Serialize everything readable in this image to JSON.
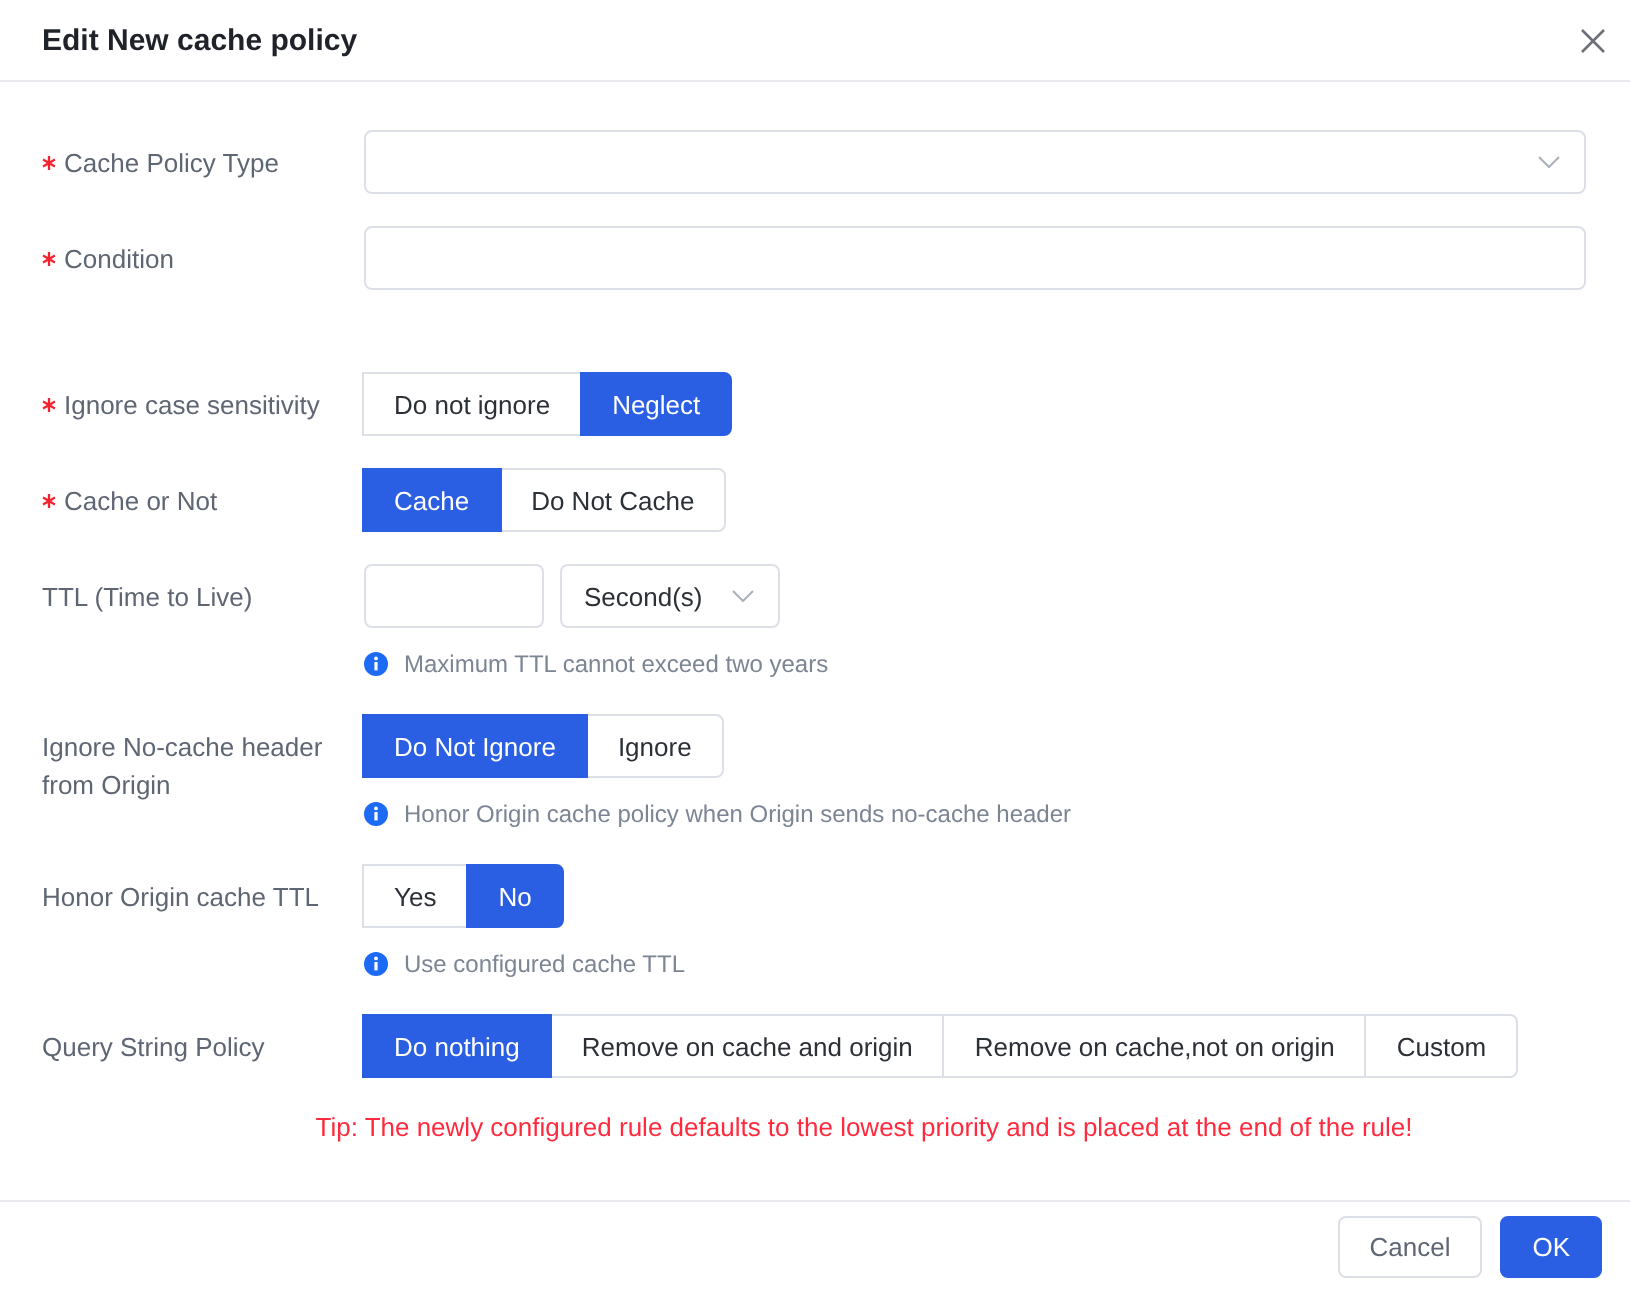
{
  "dialog": {
    "title": "Edit New cache policy"
  },
  "form": {
    "fields": [
      {
        "kind": "select",
        "label": "Cache Policy Type",
        "required": true
      },
      {
        "kind": "input",
        "label": "Condition",
        "required": true
      },
      {
        "kind": "segmented",
        "label": "Ignore case sensitivity",
        "required": true,
        "options": [
          {
            "label": "Do not ignore",
            "selected": false
          },
          {
            "label": "Neglect",
            "selected": true
          }
        ]
      },
      {
        "kind": "segmented",
        "label": "Cache or Not",
        "required": true,
        "options": [
          {
            "label": "Cache",
            "selected": true
          },
          {
            "label": "Do Not Cache",
            "selected": false
          }
        ]
      },
      {
        "kind": "ttl",
        "label": "TTL (Time to Live)",
        "required": false,
        "unit": "Second(s)",
        "hint": "Maximum TTL cannot exceed two years"
      },
      {
        "kind": "segmented",
        "label": "Ignore No-cache header from Origin",
        "required": false,
        "options": [
          {
            "label": "Do Not Ignore",
            "selected": true
          },
          {
            "label": "Ignore",
            "selected": false
          }
        ],
        "hint": "Honor Origin cache policy when Origin sends no-cache header"
      },
      {
        "kind": "segmented",
        "label": "Honor Origin cache TTL",
        "required": false,
        "options": [
          {
            "label": "Yes",
            "selected": false
          },
          {
            "label": "No",
            "selected": true
          }
        ],
        "hint": "Use configured cache TTL"
      },
      {
        "kind": "segmented",
        "label": "Query String Policy",
        "required": false,
        "options": [
          {
            "label": "Do nothing",
            "selected": true
          },
          {
            "label": "Remove on cache and origin",
            "selected": false
          },
          {
            "label": "Remove on cache,not on origin",
            "selected": false
          },
          {
            "label": "Custom",
            "selected": false
          }
        ]
      }
    ]
  },
  "tip": "Tip: The newly configured rule defaults to the lowest priority and is placed at the end of the rule!",
  "footer": {
    "buttons": [
      {
        "kind": "cancel",
        "label": "Cancel"
      },
      {
        "kind": "confirm",
        "label": "OK"
      }
    ]
  }
}
